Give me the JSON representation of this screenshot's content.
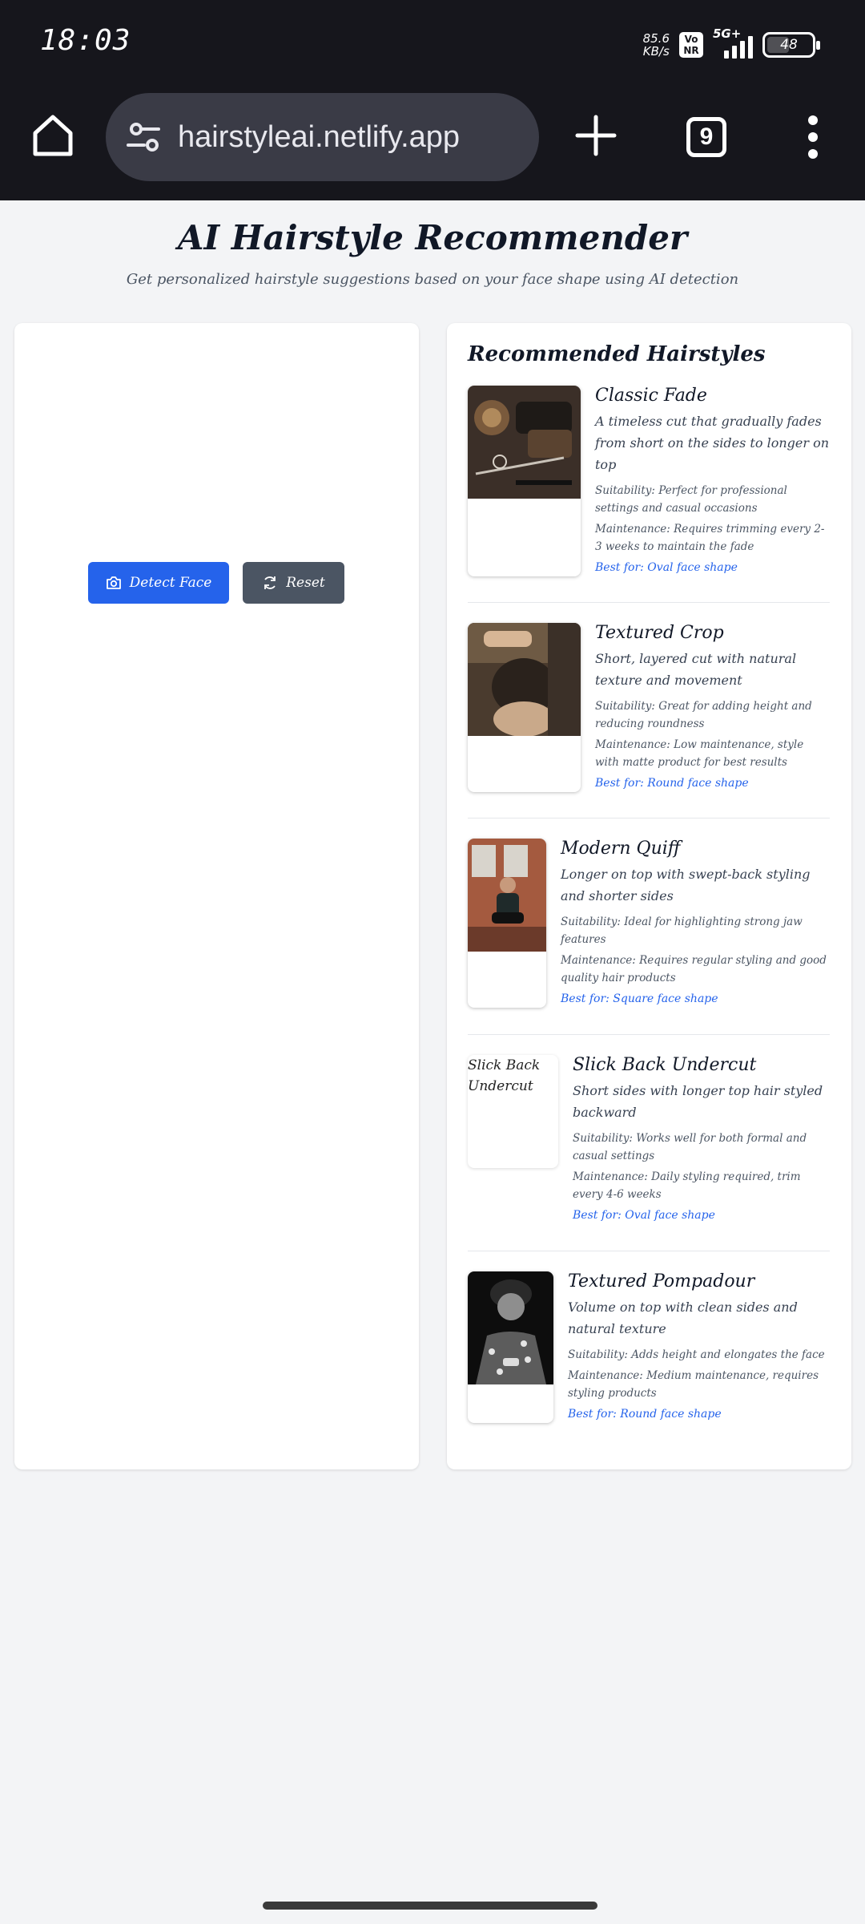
{
  "status_bar": {
    "time": "18:03",
    "net_speed_value": "85.6",
    "net_speed_unit": "KB/s",
    "volte": "Vo NR",
    "network": "5G+",
    "battery": "48"
  },
  "browser": {
    "url": "hairstyleai.netlify.app",
    "tab_count": "9"
  },
  "page": {
    "title": "AI Hairstyle Recommender",
    "subtitle": "Get personalized hairstyle suggestions based on your face shape using AI detection"
  },
  "controls": {
    "detect_label": "Detect Face",
    "reset_label": "Reset"
  },
  "recommendations": {
    "heading": "Recommended Hairstyles",
    "items": [
      {
        "name": "Classic Fade",
        "description": "A timeless cut that gradually fades from short on the sides to longer on top",
        "suitability": "Suitability: Perfect for professional settings and casual occasions",
        "maintenance": "Maintenance: Requires trimming every 2-3 weeks to maintain the fade",
        "best_for": "Best for: Oval face shape",
        "image": "barber-tools-photo"
      },
      {
        "name": "Textured Crop",
        "description": "Short, layered cut with natural texture and movement",
        "suitability": "Suitability: Great for adding height and reducing roundness",
        "maintenance": "Maintenance: Low maintenance, style with matte product for best results",
        "best_for": "Best for: Round face shape",
        "image": "haircut-photo"
      },
      {
        "name": "Modern Quiff",
        "description": "Longer on top with swept-back styling and shorter sides",
        "suitability": "Suitability: Ideal for highlighting strong jaw features",
        "maintenance": "Maintenance: Requires regular styling and good quality hair products",
        "best_for": "Best for: Square face shape",
        "image": "man-sitting-photo"
      },
      {
        "name": "Slick Back Undercut",
        "description": "Short sides with longer top hair styled backward",
        "suitability": "Suitability: Works well for both formal and casual settings",
        "maintenance": "Maintenance: Daily styling required, trim every 4-6 weeks",
        "best_for": "Best for: Oval face shape",
        "image_alt": "Slick Back Undercut"
      },
      {
        "name": "Textured Pompadour",
        "description": "Volume on top with clean sides and natural texture",
        "suitability": "Suitability: Adds height and elongates the face",
        "maintenance": "Maintenance: Medium maintenance, requires styling products",
        "best_for": "Best for: Round face shape",
        "image": "bw-portrait-photo"
      }
    ]
  },
  "colors": {
    "primary": "#2563eb",
    "secondary": "#4b5563",
    "page_bg": "#f3f4f6",
    "chrome_bg": "#16161c"
  }
}
